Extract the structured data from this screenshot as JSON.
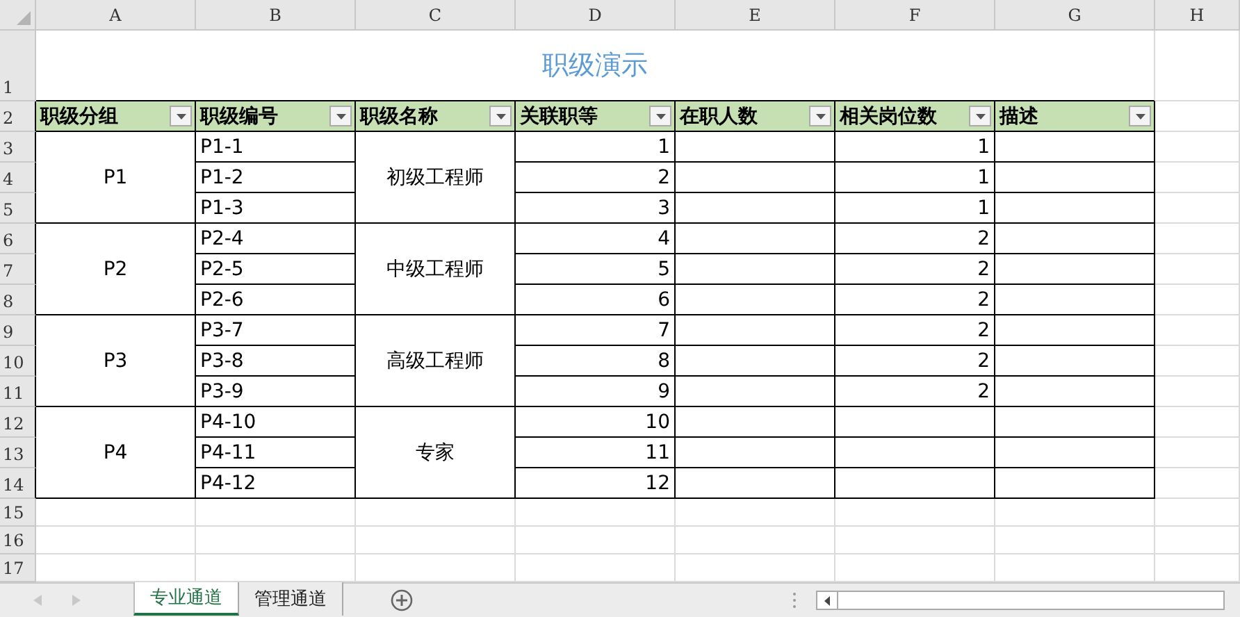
{
  "columns": [
    "A",
    "B",
    "C",
    "D",
    "E",
    "F",
    "G",
    "H"
  ],
  "row_numbers": [
    "1",
    "2",
    "3",
    "4",
    "5",
    "6",
    "7",
    "8",
    "9",
    "10",
    "11",
    "12",
    "13",
    "14",
    "15",
    "16",
    "17"
  ],
  "title": "职级演示",
  "headers": [
    "职级分组",
    "职级编号",
    "职级名称",
    "关联职等",
    "在职人数",
    "相关岗位数",
    "描述"
  ],
  "groups": [
    {
      "group": "P1",
      "name": "初级工程师",
      "rows": [
        {
          "code": "P1-1",
          "grade": "1",
          "positions": "1"
        },
        {
          "code": "P1-2",
          "grade": "2",
          "positions": "1"
        },
        {
          "code": "P1-3",
          "grade": "3",
          "positions": "1"
        }
      ]
    },
    {
      "group": "P2",
      "name": "中级工程师",
      "rows": [
        {
          "code": "P2-4",
          "grade": "4",
          "positions": "2"
        },
        {
          "code": "P2-5",
          "grade": "5",
          "positions": "2"
        },
        {
          "code": "P2-6",
          "grade": "6",
          "positions": "2"
        }
      ]
    },
    {
      "group": "P3",
      "name": "高级工程师",
      "rows": [
        {
          "code": "P3-7",
          "grade": "7",
          "positions": "2"
        },
        {
          "code": "P3-8",
          "grade": "8",
          "positions": "2"
        },
        {
          "code": "P3-9",
          "grade": "9",
          "positions": "2"
        }
      ]
    },
    {
      "group": "P4",
      "name": "专家",
      "rows": [
        {
          "code": "P4-10",
          "grade": "10"
        },
        {
          "code": "P4-11",
          "grade": "11"
        },
        {
          "code": "P4-12",
          "grade": "12"
        }
      ]
    }
  ],
  "sheet_tabs": [
    {
      "label": "专业通道",
      "selected": true
    },
    {
      "label": "管理通道",
      "selected": false
    }
  ]
}
